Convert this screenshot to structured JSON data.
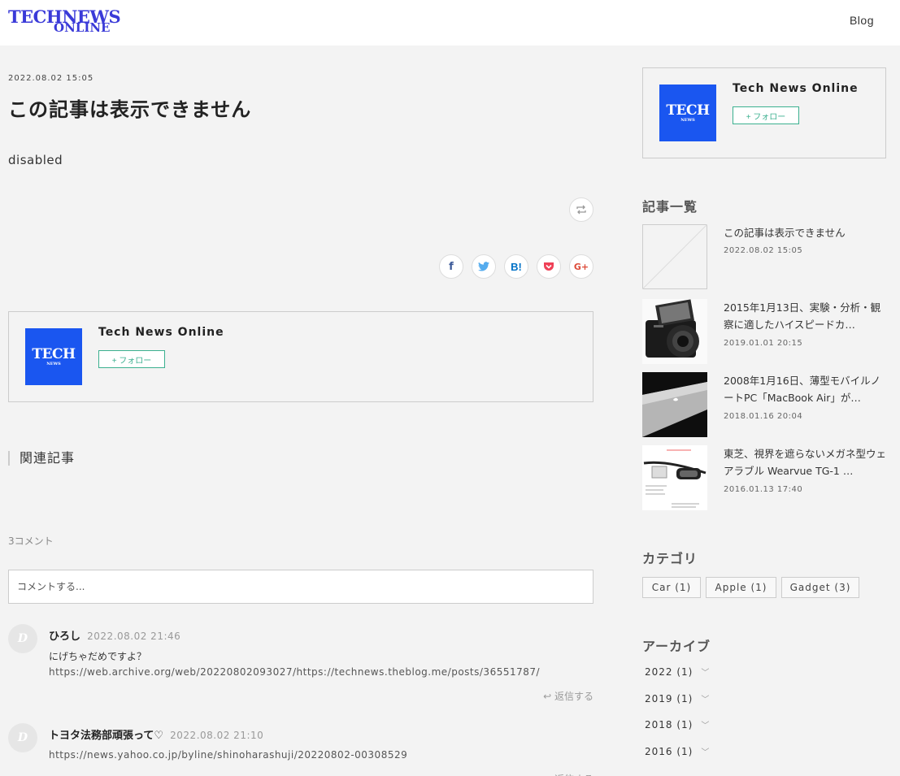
{
  "header": {
    "logo_line1": "TECHNEWS",
    "logo_line2": "ONLINE",
    "nav_blog": "Blog"
  },
  "post": {
    "date": "2022.08.02 15:05",
    "title": "この記事は表示できません",
    "body": "disabled",
    "reblog_icon": "reblog-icon",
    "share": {
      "facebook": "f",
      "twitter": "twitter-bird-icon",
      "hatena": "B!",
      "pocket": "pocket-icon",
      "googleplus": "G+"
    }
  },
  "author": {
    "avatar_line1": "TECH",
    "avatar_line2": "NEWS",
    "name": "Tech News Online",
    "follow_label": "+ フォロー",
    "avatar_color": "#1a56f0",
    "follow_color": "#3bb08f"
  },
  "related": {
    "heading": "関連記事"
  },
  "comments": {
    "count_label": "3コメント",
    "input_placeholder": "コメントする...",
    "reply_label": "返信する",
    "items": [
      {
        "author": "ひろし",
        "time": "2022.08.02 21:46",
        "text": "にげちゃだめですよ？",
        "link": "https://web.archive.org/web/20220802093027/https://technews.theblog.me/posts/36551787/"
      },
      {
        "author": "トヨタ法務部頑張って♡",
        "time": "2022.08.02 21:10",
        "text": "",
        "link": "https://news.yahoo.co.jp/byline/shinoharashuji/20220802-00308529"
      }
    ]
  },
  "sidebar": {
    "articles_heading": "記事一覧",
    "articles": [
      {
        "title": "この記事は表示できません",
        "date": "2022.08.02 15:05"
      },
      {
        "title": "2015年1月13日、実験・分析・観察に適したハイスピードカ…",
        "date": "2019.01.01 20:15"
      },
      {
        "title": "2008年1月16日、薄型モバイルノートPC「MacBook Air」が…",
        "date": "2018.01.16 20:04"
      },
      {
        "title": "東芝、視界を遮らないメガネ型ウェアラブル Wearvue TG-1 …",
        "date": "2016.01.13 17:40"
      }
    ],
    "categories_heading": "カテゴリ",
    "categories": [
      "Car (1)",
      "Apple (1)",
      "Gadget (3)"
    ],
    "archive_heading": "アーカイブ",
    "archive": [
      "2022 (1)",
      "2019 (1)",
      "2018 (1)",
      "2016 (1)"
    ]
  }
}
